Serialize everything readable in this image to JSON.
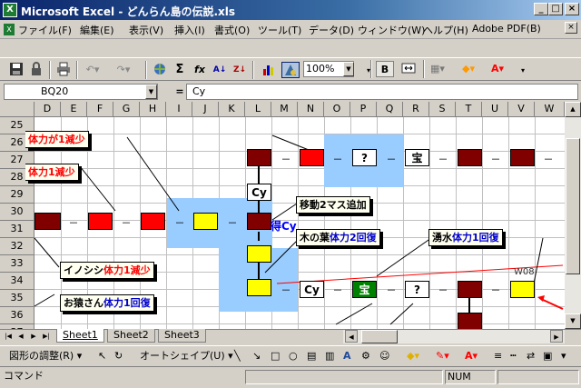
{
  "window": {
    "app_icon": "excel-icon",
    "title": "Microsoft Excel - どんらん島の伝説.xls",
    "minimize": "_",
    "maximize": "□",
    "close": "×"
  },
  "menu": {
    "items": [
      "ファイル(F)",
      "編集(E)",
      "表示(V)",
      "挿入(I)",
      "書式(O)",
      "ツール(T)",
      "データ(D)",
      "ウィンドウ(W)",
      "ヘルプ(H)",
      "Adobe PDF(B)"
    ],
    "doc_close": "×"
  },
  "toolbar": {
    "zoom": "100%",
    "bold": "B",
    "sum": "Σ",
    "fx": "fx",
    "sort_asc": "A↓",
    "sort_desc": "Z↓"
  },
  "formula_bar": {
    "name_box": "BQ20",
    "equals": "=",
    "content": "Cy"
  },
  "columns": [
    "D",
    "E",
    "F",
    "G",
    "H",
    "I",
    "J",
    "K",
    "L",
    "M",
    "N",
    "O",
    "P",
    "Q",
    "R",
    "S",
    "T",
    "U",
    "V",
    "W"
  ],
  "rows": [
    "25",
    "26",
    "27",
    "28",
    "29",
    "30",
    "31",
    "32",
    "33",
    "34",
    "35",
    "36",
    "37"
  ],
  "board": {
    "dash": "－",
    "cy_label_1": "Cy",
    "cy_label_2": "Cy",
    "mark_q1": "?",
    "mark_treasure1": "宝",
    "mark_treasure2": "宝",
    "mark_q2": "?",
    "blue_cy": "得Cy",
    "w08": "W08"
  },
  "callouts": {
    "c1": {
      "part1": "体力が1減少",
      "part2": ""
    },
    "c2": {
      "part1": "体力1減少",
      "part2": ""
    },
    "c3": {
      "part1": "移動2マス追加",
      "part2": ""
    },
    "c4": {
      "part1": "木の葉",
      "part2": "体力2回復"
    },
    "c5": {
      "part1": "湧水",
      "part2": "体力1回復"
    },
    "c6": {
      "part1": "イノシシ",
      "part2": "体力1減少"
    },
    "c7": {
      "part1": "お猿さん",
      "part2": "体力1回復"
    }
  },
  "sheets": [
    "Sheet1",
    "Sheet2",
    "Sheet3"
  ],
  "drawing": {
    "adjust": "図形の調整(R) ▾",
    "autoshape": "オートシェイプ(U) ▾"
  },
  "status": {
    "mode": "コマンド",
    "num": "NUM"
  },
  "colors": {
    "dark_cell": "#800000",
    "red_cell": "#ff0000",
    "yellow_cell": "#ffff00",
    "green_cell": "#008000",
    "blue_area": "#99ccff"
  }
}
